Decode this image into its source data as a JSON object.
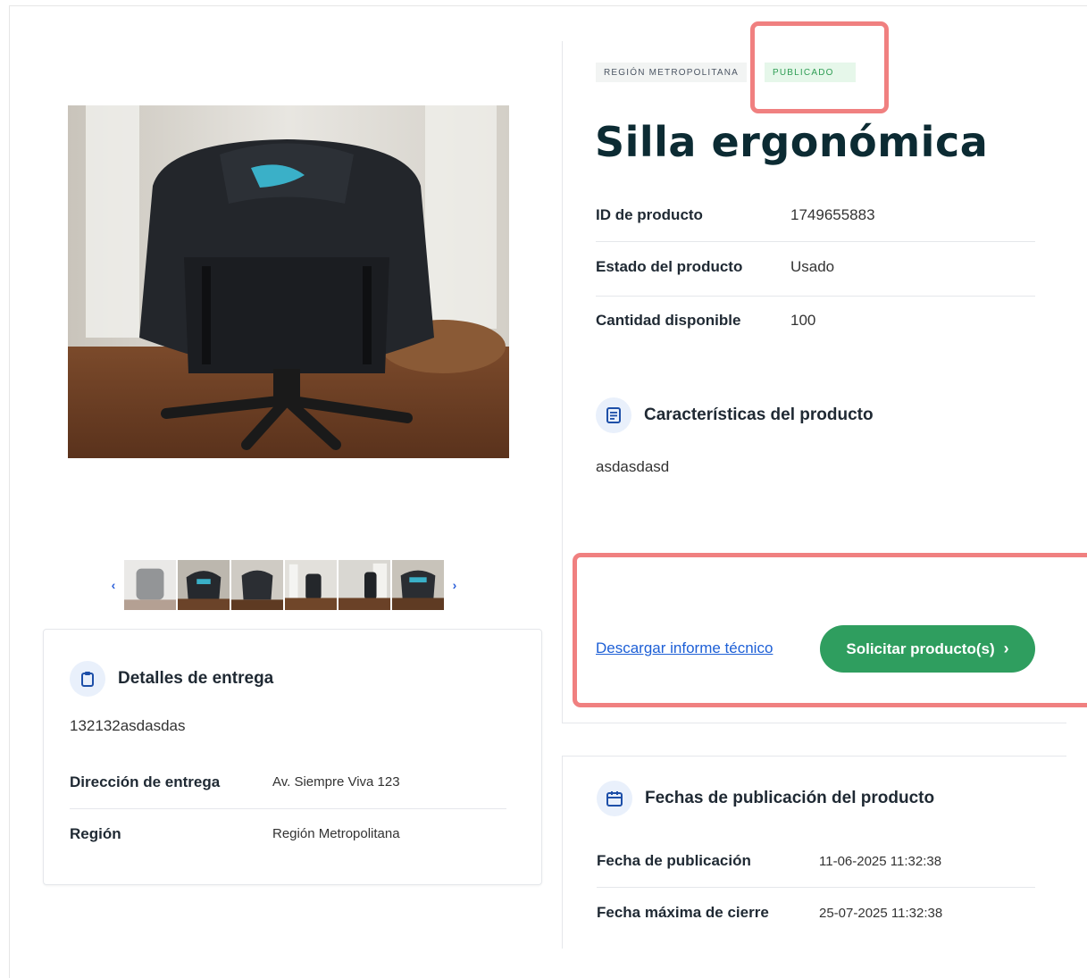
{
  "gallery": {
    "main_image_alt": "Silla ergonómica",
    "thumbnail_count": 6,
    "active_index": 0,
    "prev_icon": "chevron-left-icon",
    "next_icon": "chevron-right-icon"
  },
  "delivery": {
    "title": "Detalles de entrega",
    "icon": "clipboard-icon",
    "reference": "132132asdasdas",
    "rows": [
      {
        "label": "Dirección de entrega",
        "value": "Av. Siempre Viva 123"
      },
      {
        "label": "Región",
        "value": "Región Metropolitana"
      }
    ]
  },
  "product": {
    "region_badge": "Región Metropolitana",
    "status_badge": "Publicado",
    "title": "Silla ergonómica",
    "specs": [
      {
        "label": "ID de producto",
        "value": "1749655883"
      },
      {
        "label": "Estado del producto",
        "value": "Usado"
      },
      {
        "label": "Cantidad disponible",
        "value": "100"
      }
    ],
    "features_title": "Características del producto",
    "features_icon": "document-list-icon",
    "features_text": "asdasdasd",
    "report_link": "Descargar informe técnico",
    "request_button": "Solicitar producto(s)"
  },
  "dates": {
    "title": "Fechas de publicación del producto",
    "icon": "calendar-icon",
    "rows": [
      {
        "label": "Fecha de publicación",
        "value": "11-06-2025 11:32:38"
      },
      {
        "label": "Fecha máxima de cierre",
        "value": "25-07-2025 11:32:38"
      }
    ]
  },
  "colors": {
    "primary_green": "#2f9e5f",
    "link_blue": "#1d5fd6",
    "annotation_red": "#f08080",
    "title_dark": "#0c2b33"
  }
}
